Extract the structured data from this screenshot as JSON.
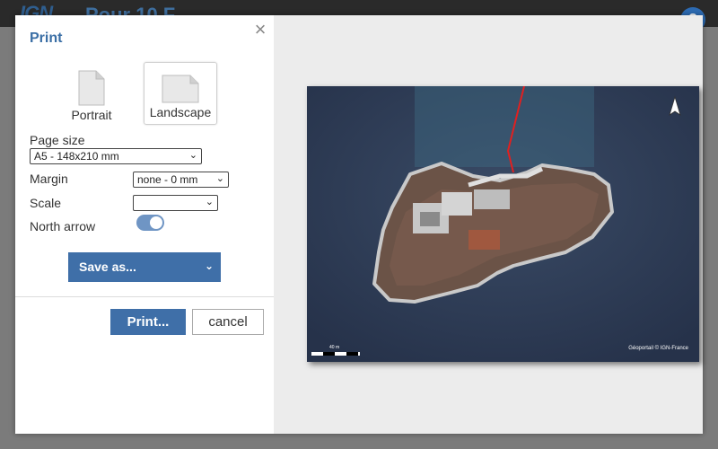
{
  "app": {
    "logo_text": "IGN",
    "title": "Pour 10 F",
    "help_label": "?"
  },
  "dialog": {
    "title": "Print",
    "close_label": "×",
    "orientation": [
      {
        "label": "Portrait",
        "selected": false
      },
      {
        "label": "Landscape",
        "selected": true
      }
    ],
    "page_size": {
      "label": "Page size",
      "value": "A5 - 148x210 mm"
    },
    "margin": {
      "label": "Margin",
      "value": "none - 0 mm"
    },
    "scale": {
      "label": "Scale",
      "value": ""
    },
    "north_arrow": {
      "label": "North arrow",
      "enabled": true
    },
    "save_as_label": "Save as...",
    "print_label": "Print...",
    "cancel_label": "cancel"
  },
  "preview": {
    "attribution": "Géoportail © IGN-France",
    "scale_label": "40 m"
  },
  "colors": {
    "accent": "#3f6fa8",
    "title": "#3a6ea5",
    "route": "#e02020"
  },
  "icons": {
    "close": "close-icon",
    "page": "page-icon",
    "north": "north-arrow-icon",
    "chevron": "chevron-down-icon"
  }
}
